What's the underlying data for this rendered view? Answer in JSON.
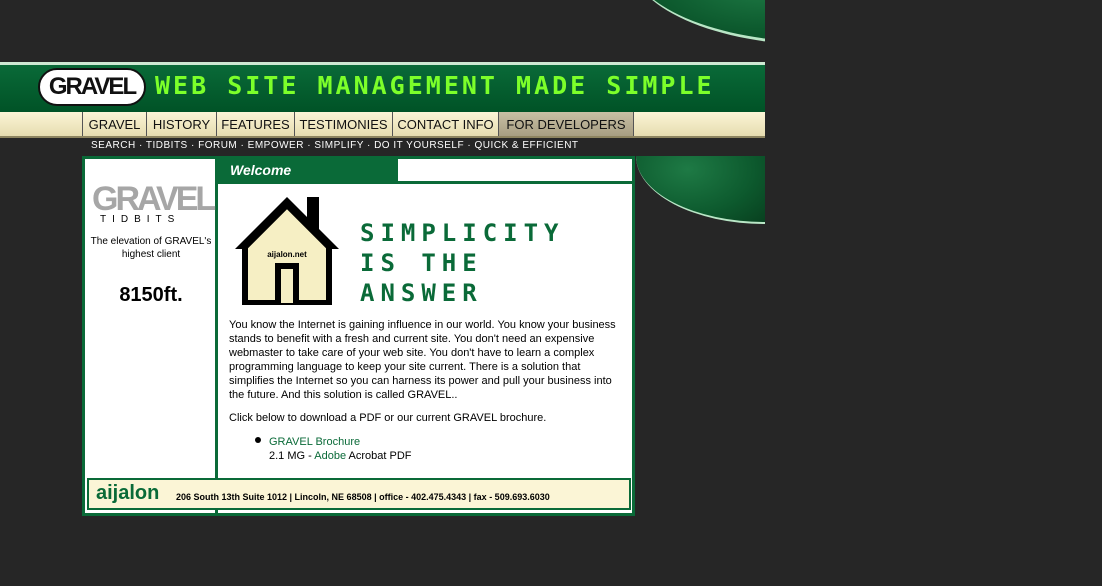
{
  "header": {
    "logo_text": "GRAVEL",
    "slogan": "WEB SITE MANAGEMENT MADE SIMPLE"
  },
  "nav": {
    "items": [
      {
        "label": "GRAVEL"
      },
      {
        "label": "HISTORY"
      },
      {
        "label": "FEATURES"
      },
      {
        "label": "TESTIMONIES"
      },
      {
        "label": "CONTACT INFO"
      },
      {
        "label": "FOR DEVELOPERS"
      }
    ],
    "active": "FOR DEVELOPERS"
  },
  "subnav": {
    "text": "SEARCH · TIDBITS · FORUM · EMPOWER · SIMPLIFY · DO IT YOURSELF · QUICK & EFFICIENT"
  },
  "sidebar": {
    "logo_text": "GRAVEL",
    "tidbits_label": "TIDBITS",
    "fact_text": "The elevation of GRAVEL's highest client",
    "fact_value": "8150ft."
  },
  "main": {
    "tab_label": "Welcome",
    "house_label": "aijalon.net",
    "headline": "SIMPLICITY\nIS THE\nANSWER",
    "paragraph": "You know the Internet is gaining influence in our world. You know your business stands to benefit with a fresh and current site. You don't need an expensive webmaster to take care of your web site. You don't have to learn a complex programming language to keep your site current. There is a solution that simplifies the Internet so you can harness its power and pull your business into the future. And this solution is called GRAVEL..",
    "download_text": "Click below to download a PDF or our current GRAVEL brochure.",
    "brochure_link": "GRAVEL Brochure",
    "size_prefix": "2.1 MG - ",
    "adobe_link": "Adobe",
    "size_suffix": " Acrobat PDF"
  },
  "footer": {
    "brand": "aijalon",
    "info": "206 South 13th  Suite 1012  |  Lincoln,  NE  68508  |  office - 402.475.4343  |  fax - 509.693.6030"
  },
  "colors": {
    "brand_green": "#0a6a38",
    "slogan_green": "#7cff2a",
    "background": "#262626",
    "nav_bg": "#fbf5d6"
  }
}
